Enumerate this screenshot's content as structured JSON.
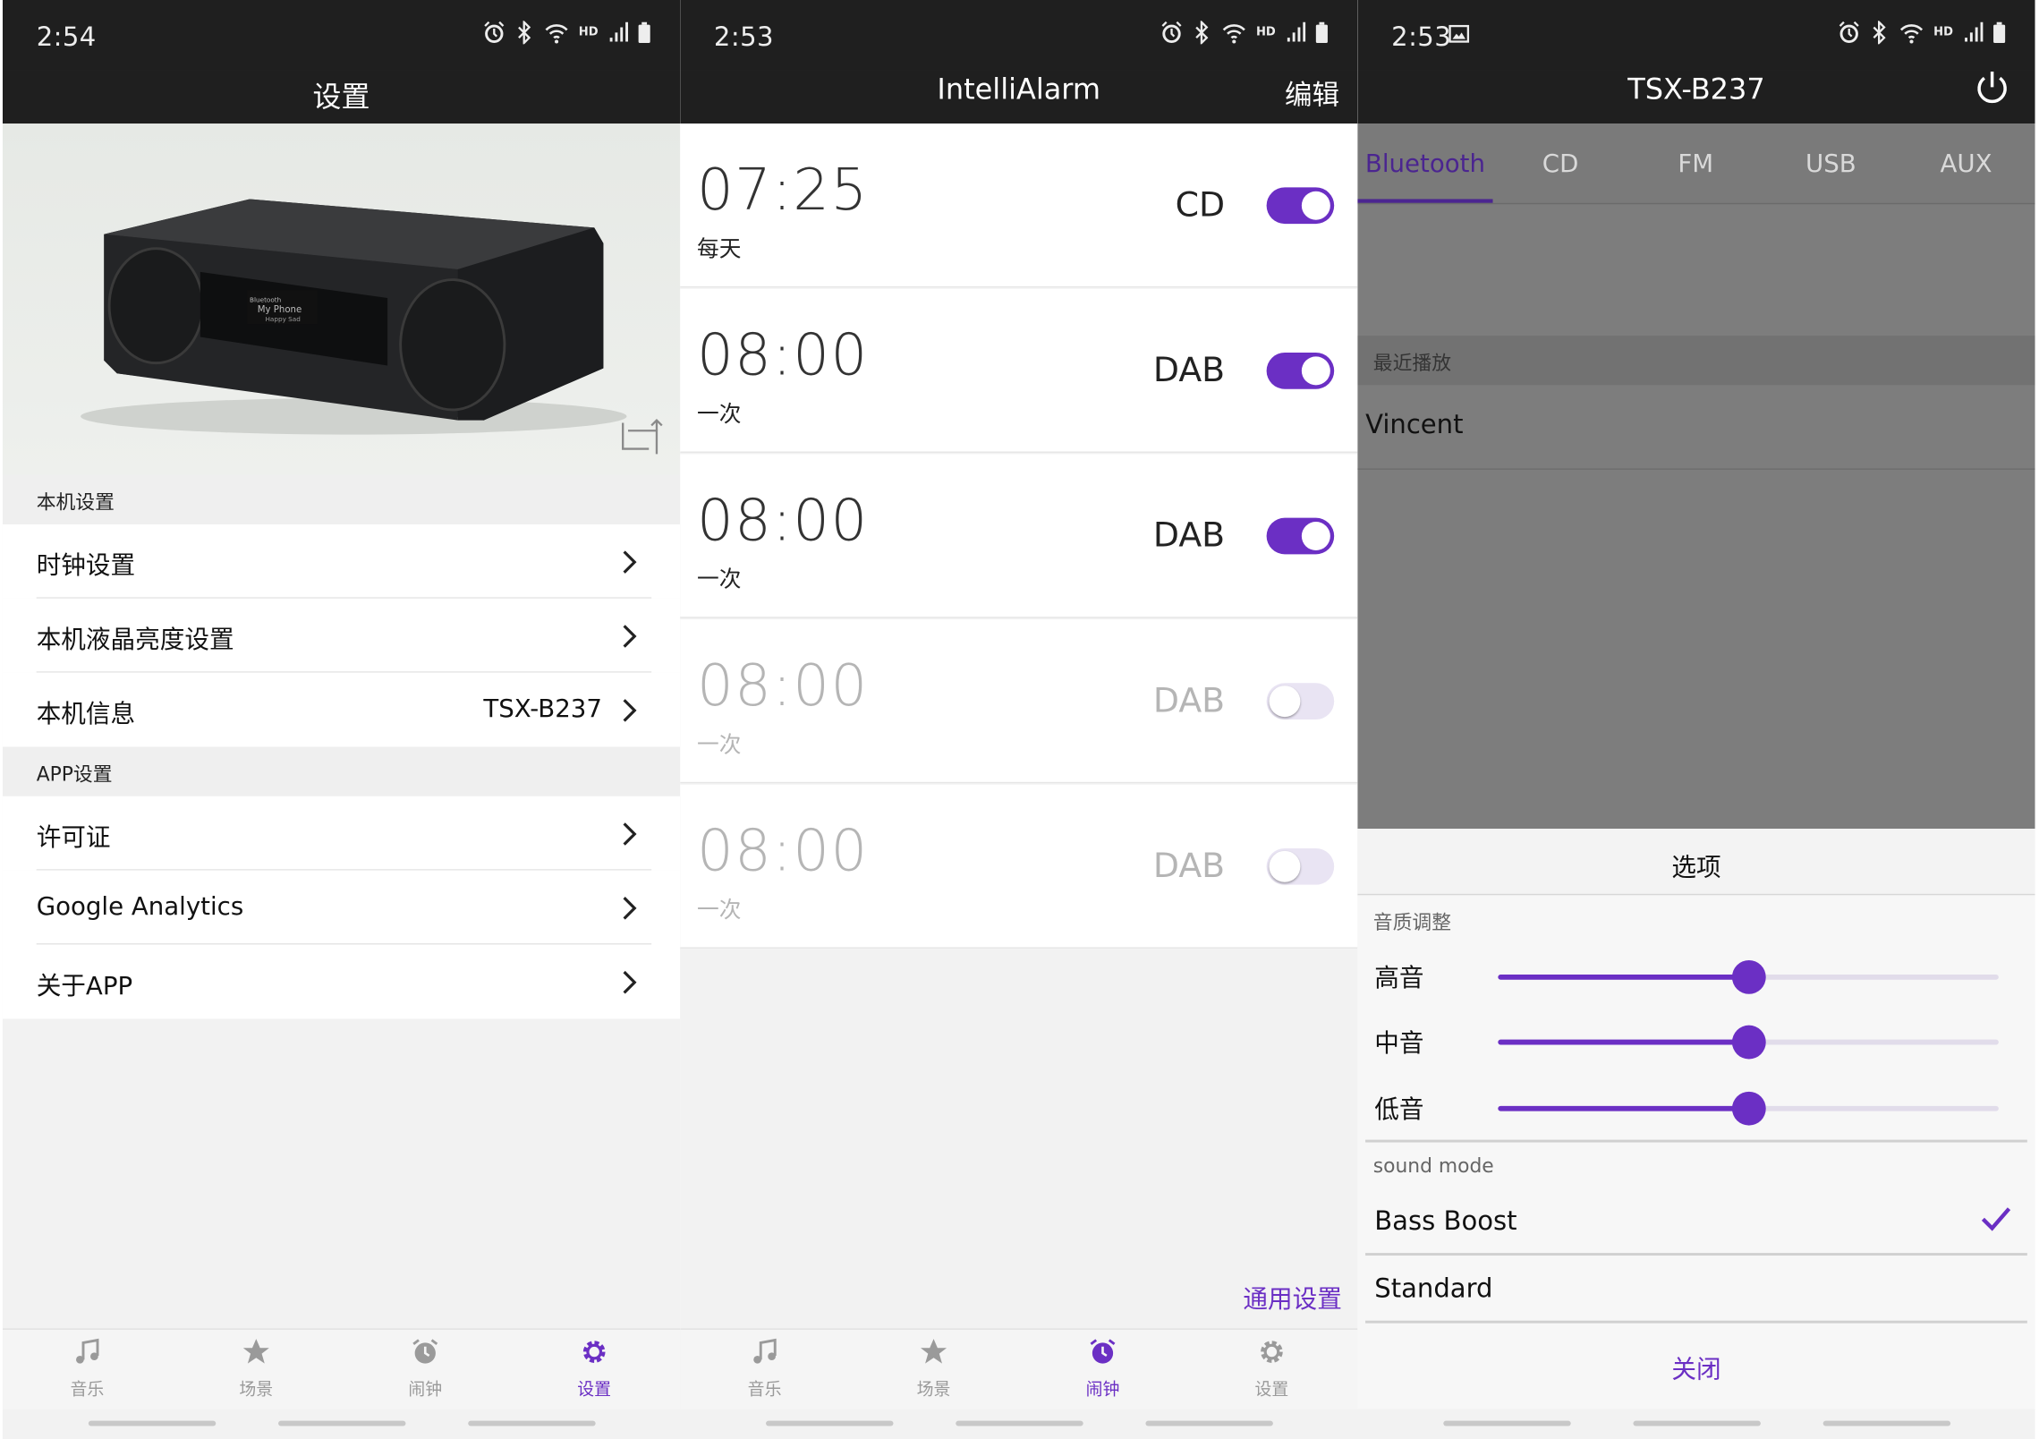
{
  "theme": {
    "accent": "#6b2fc4",
    "header_bg": "#1f1f1f",
    "disabled_text": "#b5b5b5",
    "overlay": "#7d7d7d"
  },
  "screens": [
    {
      "status": {
        "time": "2:54",
        "icons": [
          "alarm-icon",
          "bluetooth-icon",
          "wifi-icon",
          "hd-label",
          "signal-icon",
          "battery-icon"
        ],
        "hd": "HD"
      },
      "appbar": {
        "title": "设置"
      },
      "hero": {
        "icon": "rotate-device-icon",
        "speaker_text": [
          "Bluetooth",
          "My Phone",
          "Happy Sad"
        ]
      },
      "sections": [
        {
          "header": "本机设置",
          "rows": [
            {
              "label": "时钟设置",
              "value": ""
            },
            {
              "label": "本机液晶亮度设置",
              "value": ""
            },
            {
              "label": "本机信息",
              "value": "TSX-B237"
            }
          ]
        },
        {
          "header": "APP设置",
          "rows": [
            {
              "label": "许可证",
              "value": ""
            },
            {
              "label": "Google Analytics",
              "value": ""
            },
            {
              "label": "关于APP",
              "value": ""
            }
          ]
        }
      ],
      "tabbar": {
        "active": 3,
        "tabs": [
          {
            "label": "音乐",
            "icon": "music-note-icon"
          },
          {
            "label": "场景",
            "icon": "star-icon"
          },
          {
            "label": "闹钟",
            "icon": "alarm-clock-icon"
          },
          {
            "label": "设置",
            "icon": "gear-icon"
          }
        ]
      }
    },
    {
      "status": {
        "time": "2:53",
        "hd": "HD"
      },
      "appbar": {
        "title": "IntelliAlarm",
        "action": "编辑"
      },
      "alarms": [
        {
          "time": "07:25",
          "repeat": "每天",
          "source": "CD",
          "enabled": true
        },
        {
          "time": "08:00",
          "repeat": "一次",
          "source": "DAB",
          "enabled": true
        },
        {
          "time": "08:00",
          "repeat": "一次",
          "source": "DAB",
          "enabled": true
        },
        {
          "time": "08:00",
          "repeat": "一次",
          "source": "DAB",
          "enabled": false
        },
        {
          "time": "08:00",
          "repeat": "一次",
          "source": "DAB",
          "enabled": false
        }
      ],
      "general_settings": "通用设置",
      "tabbar": {
        "active": 2
      }
    },
    {
      "status": {
        "time": "2:53",
        "hd": "HD",
        "extra_icon": "image-icon"
      },
      "appbar": {
        "title": "TSX-B237",
        "action_icon": "power-icon"
      },
      "source_tabs": {
        "active": 0,
        "items": [
          "Bluetooth",
          "CD",
          "FM",
          "USB",
          "AUX"
        ]
      },
      "recent": {
        "header": "最近播放",
        "items": [
          "Vincent"
        ]
      },
      "options": {
        "title": "选项",
        "eq_header": "音质调整",
        "eq": [
          {
            "label": "高音",
            "level": 0.5
          },
          {
            "label": "中音",
            "level": 0.5
          },
          {
            "label": "低音",
            "level": 0.5
          }
        ],
        "mode_header": "sound mode",
        "modes": [
          {
            "label": "Bass Boost",
            "selected": true
          },
          {
            "label": "Standard",
            "selected": false
          }
        ],
        "close": "关闭"
      }
    }
  ]
}
